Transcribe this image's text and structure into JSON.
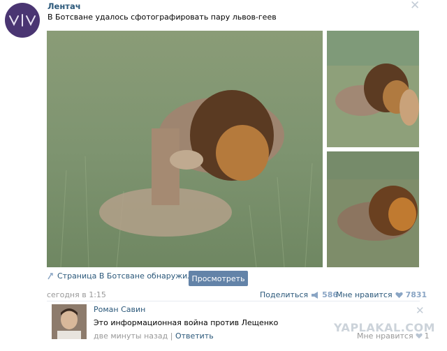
{
  "post": {
    "author": "Лентач",
    "text": "В Ботсване удалось сфотографировать пару львов-геев",
    "link_text": "Страница В Ботсване обнаружили...",
    "view_button": "Просмотреть",
    "date": "сегодня в 1:15",
    "share_label": "Поделиться",
    "share_count": "586",
    "like_label": "Мне нравится",
    "like_count": "7831"
  },
  "comment": {
    "author": "Роман Савин",
    "text": "Это информационная война против Лещенко",
    "time": "две минуты назад",
    "separator": "|",
    "reply_label": "Ответить",
    "like_label": "Мне нравится",
    "like_count": "1"
  },
  "watermark": "YAPLAKAL.COM",
  "icons": {
    "avatar": "lentach-logo",
    "close": "close-icon",
    "link": "link-icon",
    "share": "megaphone-icon",
    "like": "heart-icon"
  },
  "colors": {
    "link": "#2b587a",
    "button": "#6383a8",
    "muted": "#999999",
    "count": "#8aa5c4"
  }
}
